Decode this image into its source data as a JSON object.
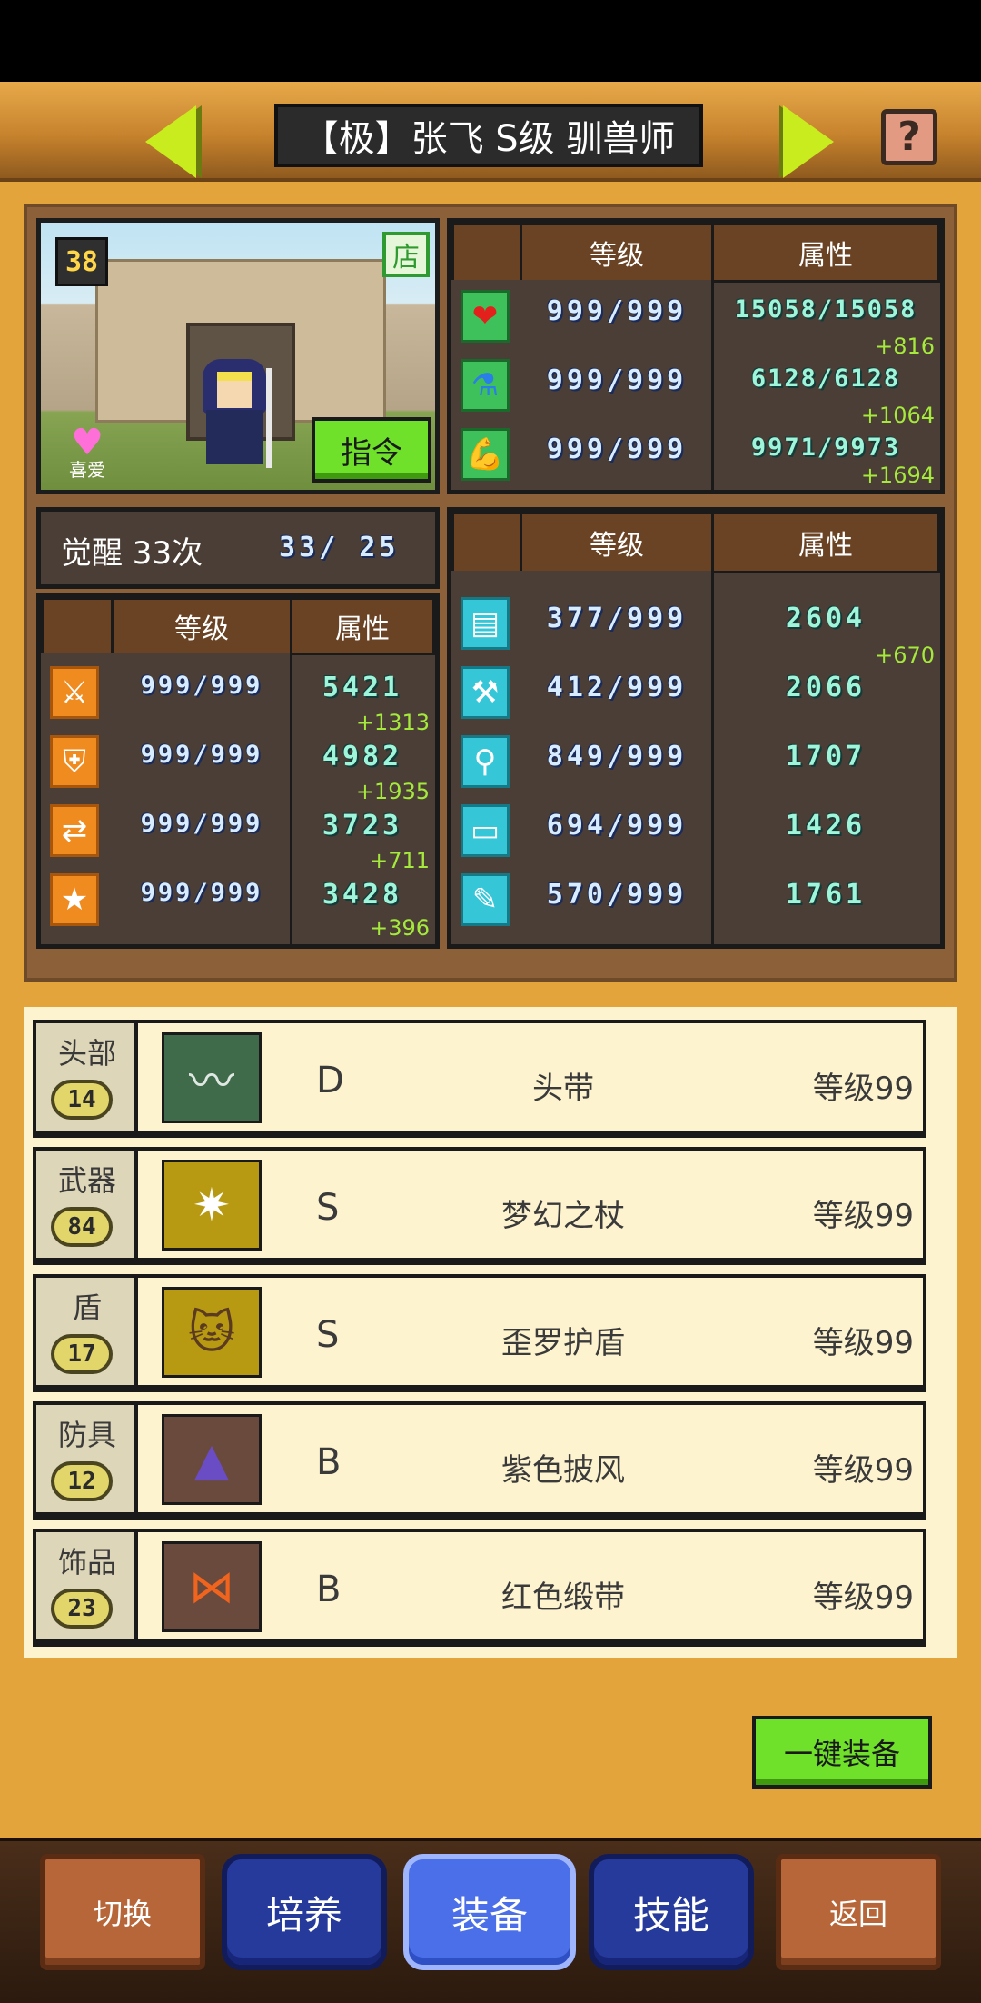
{
  "header": {
    "title": "【极】张飞 S级 驯兽师",
    "help": "?"
  },
  "character": {
    "level": "38",
    "shop_badge": "店",
    "favorite_label": "喜爱",
    "command_button": "指令"
  },
  "awaken": {
    "label": "觉醒 33次",
    "count": "33/  25"
  },
  "tables": {
    "level_header": "等级",
    "attr_header": "属性"
  },
  "top_stats": [
    {
      "icon": "heart-icon",
      "level": "999/999",
      "attr": "15058/15058",
      "bonus": "+816"
    },
    {
      "icon": "mana-potion-icon",
      "level": "999/999",
      "attr": "6128/6128",
      "bonus": "+1064"
    },
    {
      "icon": "strength-icon",
      "level": "999/999",
      "attr": "9971/9973",
      "bonus": "+1694"
    }
  ],
  "left_stats": [
    {
      "icon": "sword-icon",
      "level": "999/999",
      "attr": "5421",
      "bonus": "+1313"
    },
    {
      "icon": "shield-icon",
      "level": "999/999",
      "attr": "4982",
      "bonus": "+1935"
    },
    {
      "icon": "speed-icon",
      "level": "999/999",
      "attr": "3723",
      "bonus": "+711"
    },
    {
      "icon": "star-icon",
      "level": "999/999",
      "attr": "3428",
      "bonus": "+396"
    }
  ],
  "right_stats": [
    {
      "icon": "book-icon",
      "level": "377/999",
      "attr": "2604",
      "bonus": "+670"
    },
    {
      "icon": "hammer-icon",
      "level": "412/999",
      "attr": "2066",
      "bonus": ""
    },
    {
      "icon": "shovel-icon",
      "level": "849/999",
      "attr": "1707",
      "bonus": ""
    },
    {
      "icon": "chest-icon",
      "level": "694/999",
      "attr": "1426",
      "bonus": ""
    },
    {
      "icon": "flashlight-icon",
      "level": "570/999",
      "attr": "1761",
      "bonus": ""
    }
  ],
  "equipment": [
    {
      "slot": "头部",
      "slot_level": "14",
      "rank": "D",
      "name": "头带",
      "level": "等级99",
      "icon": "headband-icon",
      "color": "#3f6b4a"
    },
    {
      "slot": "武器",
      "slot_level": "84",
      "rank": "S",
      "name": "梦幻之杖",
      "level": "等级99",
      "icon": "staff-icon",
      "color": "#b89a12"
    },
    {
      "slot": "盾",
      "slot_level": "17",
      "rank": "S",
      "name": "歪罗护盾",
      "level": "等级99",
      "icon": "cat-shield-icon",
      "color": "#b89a12"
    },
    {
      "slot": "防具",
      "slot_level": "12",
      "rank": "B",
      "name": "紫色披风",
      "level": "等级99",
      "icon": "cloak-icon",
      "color": "#6b4a3e"
    },
    {
      "slot": "饰品",
      "slot_level": "23",
      "rank": "B",
      "name": "红色缎带",
      "level": "等级99",
      "icon": "ribbon-icon",
      "color": "#6b4a3e"
    }
  ],
  "one_key_equip": "一键装备",
  "bottom_nav": {
    "switch": "切换",
    "train": "培养",
    "equip": "装备",
    "skills": "技能",
    "back": "返回"
  }
}
